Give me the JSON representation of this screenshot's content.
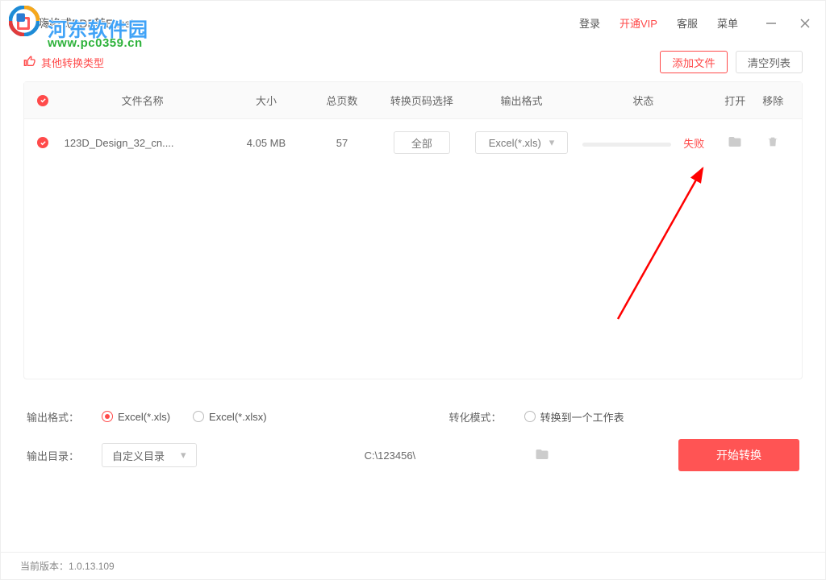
{
  "watermark": {
    "title": "河东软件园",
    "url": "www.pc0359.cn"
  },
  "app": {
    "title": "嗨格式PDF转Excel"
  },
  "header": {
    "login": "登录",
    "vip": "开通VIP",
    "support": "客服",
    "menu": "菜单"
  },
  "subbar": {
    "other_types": "其他转换类型",
    "add_file": "添加文件",
    "clear_list": "清空列表"
  },
  "table": {
    "headers": {
      "name": "文件名称",
      "size": "大小",
      "pages": "总页数",
      "page_select": "转换页码选择",
      "out_fmt": "输出格式",
      "status": "状态",
      "open": "打开",
      "remove": "移除"
    },
    "rows": [
      {
        "name": "123D_Design_32_cn....",
        "size": "4.05 MB",
        "pages": "57",
        "page_select": "全部",
        "out_fmt": "Excel(*.xls)",
        "status": "失败"
      }
    ]
  },
  "settings": {
    "out_fmt_label": "输出格式：",
    "opt_xls": "Excel(*.xls)",
    "opt_xlsx": "Excel(*.xlsx)",
    "mode_label": "转化模式：",
    "mode_single_sheet": "转换到一个工作表",
    "out_dir_label": "输出目录：",
    "dir_select": "自定义目录",
    "dir_path": "C:\\123456\\",
    "start": "开始转换"
  },
  "statusbar": {
    "version_label": "当前版本：",
    "version": "1.0.13.109"
  },
  "colors": {
    "accent": "#ff4a4a"
  }
}
